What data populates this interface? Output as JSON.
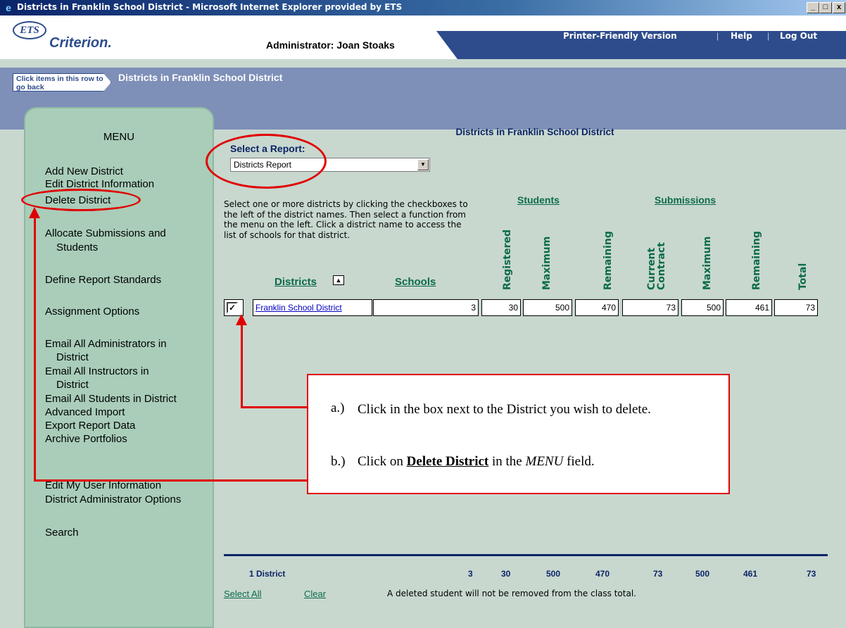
{
  "window": {
    "title": "Districts in Franklin School District - Microsoft Internet Explorer provided by ETS",
    "min": "_",
    "max": "□",
    "close": "x"
  },
  "header": {
    "logo_ets": "ETS",
    "logo_name": "Criterion.",
    "admin": "Administrator: Joan Stoaks",
    "links": {
      "printer": "Printer-Friendly Version",
      "help": "Help",
      "logout": "Log Out"
    },
    "sep": "|"
  },
  "breadcrumb": {
    "back": "Click items in this row to go back",
    "current": "Districts in Franklin School District"
  },
  "menu": {
    "title": "MENU",
    "items": [
      "Add New District",
      "Edit District Information",
      "Delete District",
      "Allocate Submissions and",
      "Students",
      "Define Report Standards",
      "Assignment Options",
      "Email All Administrators in",
      "District",
      "Email All Instructors in",
      "District",
      "Email All Students in District",
      "Advanced Import",
      "Export Report Data",
      "Archive Portfolios",
      "Edit My User Information",
      "District Administrator Options",
      "Search"
    ]
  },
  "main": {
    "title": "Districts in Franklin School District",
    "select_label": "Select a Report:",
    "select_value": "Districts Report",
    "instructions": "Select one or more districts by clicking the checkboxes to the left of the district names. Then select a function from the menu on the left. Click a district name to access the list of schools for that district.",
    "groups": {
      "students": "Students",
      "submissions": "Submissions"
    },
    "columns": {
      "districts": "Districts",
      "schools": "Schools",
      "registered": "Registered",
      "maximum": "Maximum",
      "remaining": "Remaining",
      "current_contract": "Current Contract",
      "sub_maximum": "Maximum",
      "sub_remaining": "Remaining",
      "total": "Total"
    },
    "row": {
      "checked": "✓",
      "district": "Franklin School District",
      "schools": "3",
      "registered": "30",
      "maximum": "500",
      "remaining": "470",
      "contract": "73",
      "sub_maximum": "500",
      "sub_remaining": "461",
      "total": "73"
    },
    "totals": {
      "label": "1 District",
      "schools": "3",
      "registered": "30",
      "maximum": "500",
      "remaining": "470",
      "contract": "73",
      "sub_maximum": "500",
      "sub_remaining": "461",
      "total": "73"
    },
    "footer": {
      "select_all": "Select All",
      "clear": "Clear",
      "note": "A deleted student will not be removed from the class total."
    }
  },
  "callout": {
    "a_label": "a.)",
    "a_text": "Click in the box next to the District you wish to delete.",
    "b_label": "b.)",
    "b_pre": "Click on ",
    "b_bold": "Delete District",
    "b_mid": " in the ",
    "b_italic": "MENU",
    "b_post": " field."
  },
  "colors": {
    "accent": "#2e4c8c",
    "menu_bg": "#a9cdb9",
    "annotation": "#e00000",
    "header_link": "#0c6b4a"
  }
}
